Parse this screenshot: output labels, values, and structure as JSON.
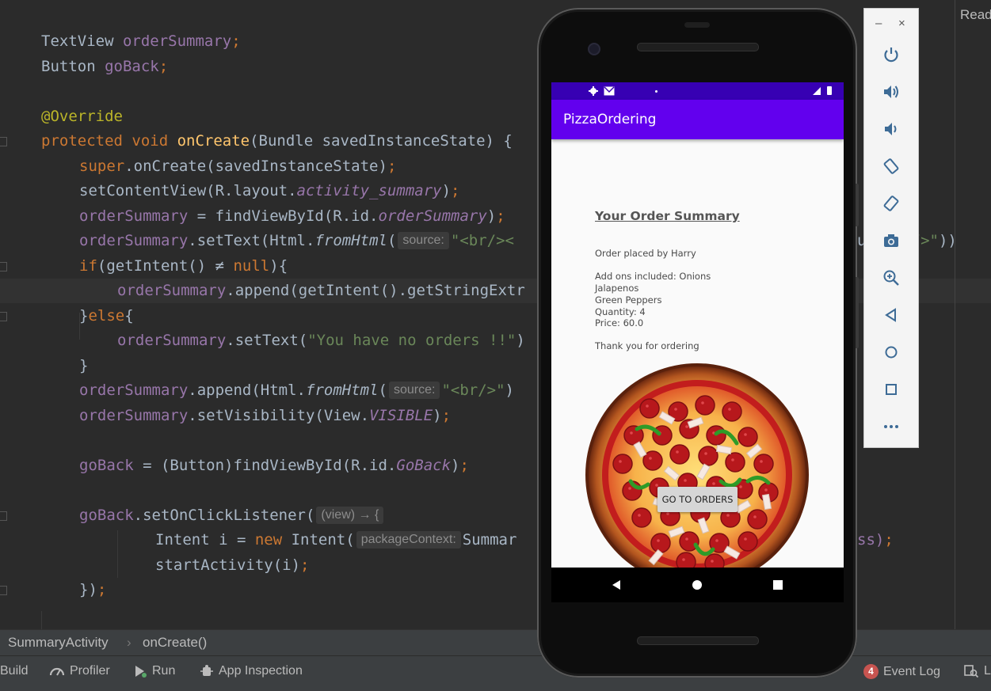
{
  "editor": {
    "lines": [
      {
        "indent": 0,
        "tokens": [
          [
            "TextView ",
            ""
          ],
          [
            "orderSummary",
            "fld"
          ],
          [
            ";",
            "kw"
          ]
        ]
      },
      {
        "indent": 0,
        "tokens": [
          [
            "Button ",
            ""
          ],
          [
            "goBack",
            "fld"
          ],
          [
            ";",
            "kw"
          ]
        ]
      },
      {
        "indent": 0,
        "tokens": []
      },
      {
        "indent": 0,
        "tokens": [
          [
            "@Override",
            "ann"
          ]
        ]
      },
      {
        "indent": 0,
        "tokens": [
          [
            "protected ",
            "kw"
          ],
          [
            "void ",
            "kw"
          ],
          [
            "onCreate",
            "fn"
          ],
          [
            "(Bundle savedInstanceState) {",
            ""
          ]
        ]
      },
      {
        "indent": 1,
        "tokens": [
          [
            "super",
            "kw"
          ],
          [
            ".onCreate(savedInstanceState)",
            ""
          ],
          [
            ";",
            "kw"
          ]
        ]
      },
      {
        "indent": 1,
        "tokens": [
          [
            "setContentView(R.layout.",
            ""
          ],
          [
            "activity_summary",
            "fld-i"
          ],
          [
            ")",
            ""
          ],
          [
            ";",
            "kw"
          ]
        ]
      },
      {
        "indent": 1,
        "tokens": [
          [
            "orderSummary",
            "fld"
          ],
          [
            " = findViewById(R.id.",
            ""
          ],
          [
            "orderSummary",
            "fld-i"
          ],
          [
            ")",
            ""
          ],
          [
            ";",
            "kw"
          ]
        ]
      },
      {
        "indent": 1,
        "tokens": [
          [
            "orderSummary",
            "fld"
          ],
          [
            ".setText(Html.",
            ""
          ],
          [
            "fromHtml",
            "mi"
          ],
          [
            "(",
            ""
          ],
          [
            "source:",
            "hint"
          ],
          [
            "\"<br/><",
            "str"
          ]
        ],
        "tail": [
          [
            "u  ",
            ""
          ],
          [
            "<br/>\"",
            "str"
          ],
          [
            "))",
            ""
          ]
        ]
      },
      {
        "indent": 1,
        "tokens": [
          [
            "if",
            "kw"
          ],
          [
            "(getIntent() ≠ ",
            ""
          ],
          [
            "null",
            "kw"
          ],
          [
            "){",
            ""
          ]
        ]
      },
      {
        "indent": 2,
        "tokens": [
          [
            "orderSummary",
            "fld"
          ],
          [
            ".append(getIntent().getStringExtr",
            ""
          ]
        ]
      },
      {
        "indent": 1,
        "tokens": [
          [
            "}",
            ""
          ],
          [
            "else",
            "kw"
          ],
          [
            "{",
            ""
          ]
        ]
      },
      {
        "indent": 2,
        "tokens": [
          [
            "orderSummary",
            "fld"
          ],
          [
            ".setText(",
            ""
          ],
          [
            "\"You have no orders !!\"",
            "str"
          ],
          [
            ")",
            ""
          ]
        ]
      },
      {
        "indent": 1,
        "tokens": [
          [
            "}",
            ""
          ]
        ]
      },
      {
        "indent": 1,
        "tokens": [
          [
            "orderSummary",
            "fld"
          ],
          [
            ".append(Html.",
            ""
          ],
          [
            "fromHtml",
            "mi"
          ],
          [
            "(",
            ""
          ],
          [
            "source:",
            "hint"
          ],
          [
            "\"<br/>\"",
            "str"
          ],
          [
            ")",
            ""
          ]
        ]
      },
      {
        "indent": 1,
        "tokens": [
          [
            "orderSummary",
            "fld"
          ],
          [
            ".setVisibility(View.",
            ""
          ],
          [
            "VISIBLE",
            "fld-i"
          ],
          [
            ")",
            ""
          ],
          [
            ";",
            "kw"
          ]
        ]
      },
      {
        "indent": 0,
        "tokens": []
      },
      {
        "indent": 1,
        "tokens": [
          [
            "goBack",
            "fld"
          ],
          [
            " = (Button)findViewById(R.id.",
            ""
          ],
          [
            "GoBack",
            "fld-i"
          ],
          [
            ")",
            ""
          ],
          [
            ";",
            "kw"
          ]
        ]
      },
      {
        "indent": 0,
        "tokens": []
      },
      {
        "indent": 1,
        "tokens": [
          [
            "goBack",
            "fld"
          ],
          [
            ".setOnClickListener(",
            ""
          ],
          [
            "(view) → {",
            "hint"
          ]
        ]
      },
      {
        "indent": 3,
        "tokens": [
          [
            "Intent i = ",
            ""
          ],
          [
            "new ",
            "kw"
          ],
          [
            "Intent(",
            ""
          ],
          [
            "packageContext:",
            "hint"
          ],
          [
            "Summar",
            ""
          ]
        ],
        "tail": [
          [
            "ss)",
            "fld"
          ],
          [
            ";",
            "kw"
          ]
        ]
      },
      {
        "indent": 3,
        "tokens": [
          [
            "startActivity(i)",
            ""
          ],
          [
            ";",
            "kw"
          ]
        ]
      },
      {
        "indent": 1,
        "tokens": [
          [
            "})",
            ""
          ],
          [
            ";",
            "kw"
          ]
        ]
      }
    ]
  },
  "breadcrumb": {
    "file": "SummaryActivity",
    "separator": "›",
    "method": "onCreate()"
  },
  "toolbar": {
    "build": "Build",
    "profiler": "Profiler",
    "run": "Run",
    "app_inspection": "App Inspection",
    "event_log_count": "4",
    "event_log": "Event Log",
    "last_char": "L"
  },
  "top_right_label": "Read",
  "emulator_panel": {
    "minimize": "–",
    "close": "×",
    "buttons": [
      "power-icon",
      "volume-up-icon",
      "volume-down-icon",
      "rotate-left-icon",
      "rotate-right-icon",
      "camera-icon",
      "zoom-icon",
      "back-icon",
      "home-icon",
      "overview-icon",
      "more-icon"
    ]
  },
  "phone": {
    "app_title": "PizzaOrdering",
    "summary_title": "Your Order Summary",
    "lines": [
      "Order placed by Harry",
      "Add ons included: Onions",
      "Jalapenos",
      "Green Peppers",
      "Quantity: 4",
      "Price: 60.0",
      "Thank you for ordering"
    ],
    "button": "GO TO ORDERS",
    "colors": {
      "status_bar": "#3700b3",
      "app_bar": "#6200ee"
    }
  }
}
